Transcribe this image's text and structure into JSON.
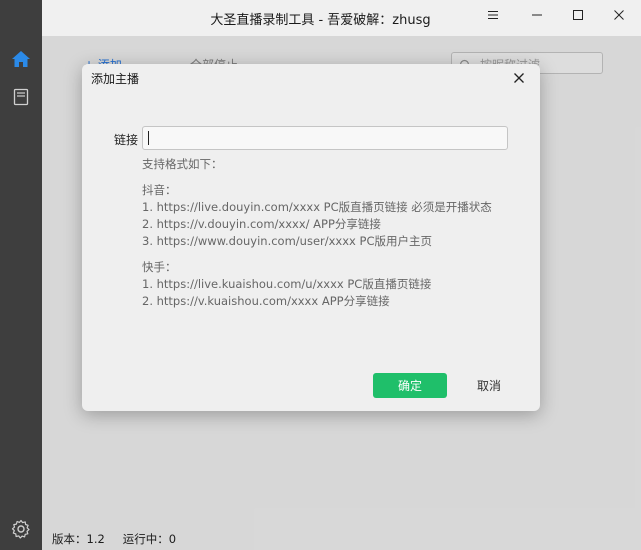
{
  "window": {
    "title": "大圣直播录制工具 - 吾爱破解：zhusg"
  },
  "sidebar": {
    "items": [
      {
        "icon": "home-icon"
      },
      {
        "icon": "document-icon"
      }
    ],
    "settings_icon": "gear-icon"
  },
  "toolbar": {
    "add_label": "+ 添加",
    "all_label": "全部停止"
  },
  "filter": {
    "placeholder": "按昵称过滤"
  },
  "status": {
    "version": "版本：1.2",
    "running": "运行中：0"
  },
  "dialog": {
    "title": "添加主播",
    "link_label": "链接",
    "link_value": "",
    "help_lines": [
      "支持格式如下：",
      "",
      "抖音：",
      "1. https://live.douyin.com/xxxx PC版直播页链接 必须是开播状态",
      "2. https://v.douyin.com/xxxx/ APP分享链接",
      "3. https://www.douyin.com/user/xxxx PC版用户主页",
      "",
      "快手：",
      "1. https://live.kuaishou.com/u/xxxx PC版直播页链接",
      "2. https://v.kuaishou.com/xxxx APP分享链接"
    ],
    "ok_label": "确定",
    "cancel_label": "取消"
  },
  "colors": {
    "accent": "#2b7de9",
    "ok_button": "#1fbf6a",
    "sidebar": "#3e3e3e"
  }
}
